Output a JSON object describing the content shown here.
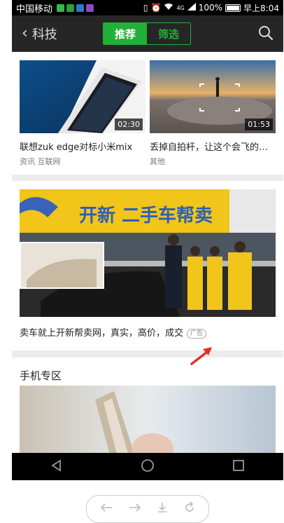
{
  "status_bar": {
    "carrier": "中国移动",
    "network": "4G",
    "battery": "100%",
    "time": "早上8:04"
  },
  "header": {
    "back_label": "科技",
    "tab_recommend": "推荐",
    "tab_filter": "筛选"
  },
  "videos": [
    {
      "title": "联想zuk edge对标小米mix",
      "tags": "资讯 互联网",
      "duration": "02:30"
    },
    {
      "title": "丢掉自拍杆，让这个会飞的…",
      "tags": "其他",
      "duration": "01:53"
    }
  ],
  "ad": {
    "text": "卖车就上开新帮卖网，真实，高价，成交",
    "badge": "广告",
    "sign_text": "开新 二手车帮卖"
  },
  "section": {
    "title": "手机专区"
  },
  "colors": {
    "accent_green": "#22b038",
    "annotation_red": "#e0302a"
  }
}
